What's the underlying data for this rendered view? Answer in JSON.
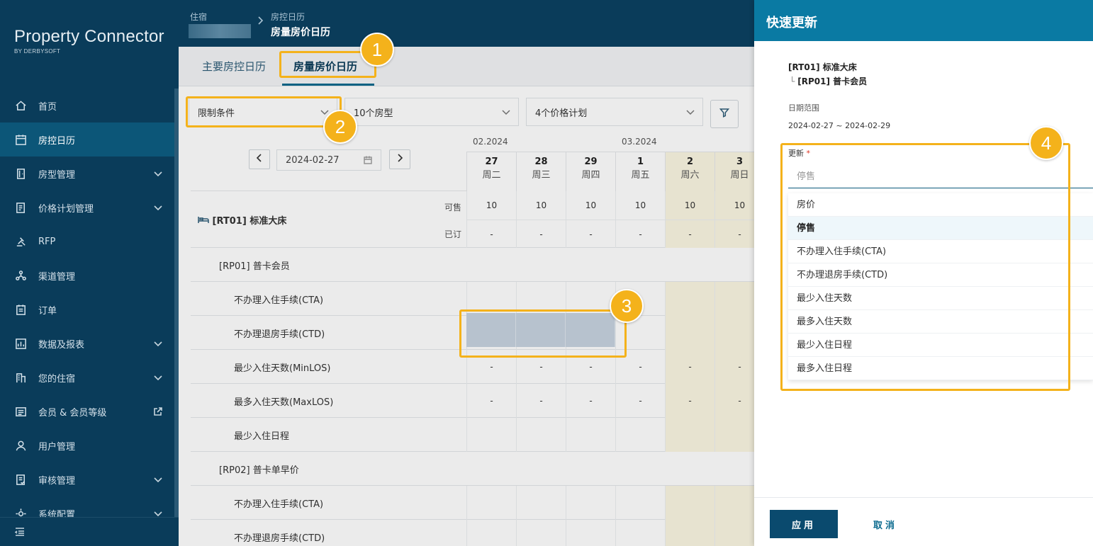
{
  "sidebar": {
    "brand_name": "Property Connector",
    "brand_sub": "BY DERBYSOFT",
    "items": [
      {
        "label": "首页",
        "icon": "home-icon",
        "active": false,
        "chevron": false
      },
      {
        "label": "房控日历",
        "icon": "calendar-icon",
        "active": true,
        "chevron": false
      },
      {
        "label": "房型管理",
        "icon": "door-icon",
        "active": false,
        "chevron": true
      },
      {
        "label": "价格计划管理",
        "icon": "price-plan-icon",
        "active": false,
        "chevron": true
      },
      {
        "label": "RFP",
        "icon": "gavel-icon",
        "active": false,
        "chevron": false
      },
      {
        "label": "渠道管理",
        "icon": "channel-icon",
        "active": false,
        "chevron": false
      },
      {
        "label": "订单",
        "icon": "order-icon",
        "active": false,
        "chevron": false
      },
      {
        "label": "数据及报表",
        "icon": "report-icon",
        "active": false,
        "chevron": true
      },
      {
        "label": "您的住宿",
        "icon": "building-icon",
        "active": false,
        "chevron": true
      },
      {
        "label": "会员 & 会员等级",
        "icon": "member-icon",
        "active": false,
        "chevron": false
      },
      {
        "label": "用户管理",
        "icon": "user-icon",
        "active": false,
        "chevron": false
      },
      {
        "label": "审核管理",
        "icon": "audit-icon",
        "active": false,
        "chevron": true
      },
      {
        "label": "系统配置",
        "icon": "settings-icon",
        "active": false,
        "chevron": true
      }
    ]
  },
  "header": {
    "crumb_parent": "住宿",
    "crumb_section": "房控日历",
    "crumb_current": "房量房价日历"
  },
  "tabs": [
    "主要房控日历",
    "房量房价日历"
  ],
  "filters": {
    "restriction": "限制条件",
    "room_types": "10个房型",
    "rate_plans": "4个价格计划"
  },
  "calendar": {
    "date": "2024-02-27",
    "months": [
      "02.2024",
      "03.2024"
    ],
    "days": [
      {
        "num": "27",
        "wk": "周二",
        "weekend": false
      },
      {
        "num": "28",
        "wk": "周三",
        "weekend": false
      },
      {
        "num": "29",
        "wk": "周四",
        "weekend": false
      },
      {
        "num": "1",
        "wk": "周五",
        "weekend": false
      },
      {
        "num": "2",
        "wk": "周六",
        "weekend": true
      },
      {
        "num": "3",
        "wk": "周日",
        "weekend": true
      }
    ],
    "room": "[RT01] 标准大床",
    "avail_label": "可售",
    "booked_label": "已订",
    "avail_values": [
      "10",
      "10",
      "10",
      "10",
      "10",
      "10"
    ],
    "booked_values": [
      "-",
      "-",
      "-",
      "-",
      "-",
      "-"
    ],
    "rp01": "[RP01] 普卡会员",
    "rp02": "[RP02] 普卡单早价",
    "rows": {
      "cta": "不办理入住手续(CTA)",
      "ctd": "不办理退房手续(CTD)",
      "minlos": "最少入住天数(MinLOS)",
      "maxlos": "最多入住天数(MaxLOS)",
      "minstay": "最少入住日程"
    },
    "dash": "-"
  },
  "panel": {
    "title": "快速更新",
    "room": "[RT01] 标准大床",
    "tree": "└",
    "rate": "[RP01] 普卡会员",
    "range_label": "日期范围",
    "range_value": "2024-02-27 ~ 2024-02-29",
    "update_label": "更新",
    "required_mark": "*",
    "update_placeholder": "停售",
    "options": [
      "房价",
      "停售",
      "不办理入住手续(CTA)",
      "不办理退房手续(CTD)",
      "最少入住天数",
      "最多入住天数",
      "最少入住日程",
      "最多入住日程"
    ],
    "selected_option": 1,
    "apply": "应用",
    "cancel": "取消"
  },
  "annotations": [
    "1",
    "2",
    "3",
    "4"
  ],
  "colors": {
    "accent": "#0a7aa3",
    "sidebar": "#0a3c5a",
    "highlight": "#f4b21b"
  }
}
